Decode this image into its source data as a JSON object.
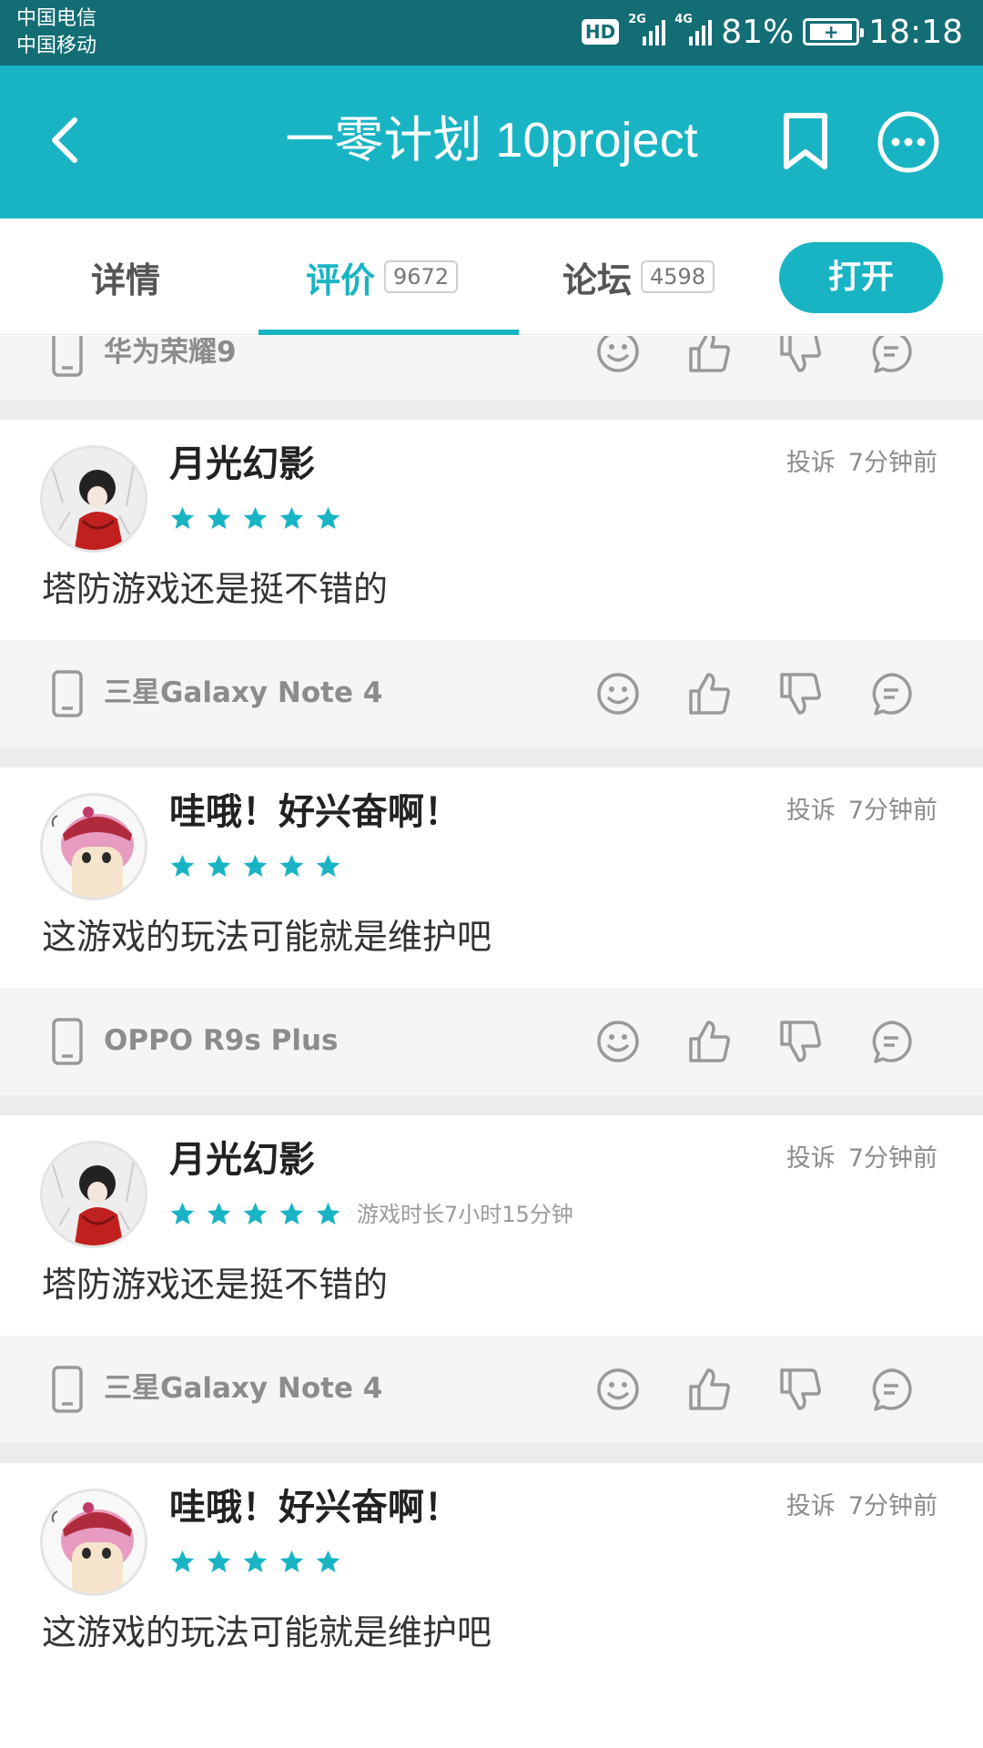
{
  "status_bar": {
    "carrier1": "中国电信",
    "carrier2": "中国移动",
    "hd": "HD",
    "net1": "2G",
    "net2": "4G",
    "battery": "81%",
    "time": "18:18"
  },
  "header": {
    "title": "一零计划 10project",
    "back_icon": "chevron-left-icon",
    "bookmark_icon": "bookmark-icon",
    "more_icon": "more-icon"
  },
  "tabs": [
    {
      "label": "详情"
    },
    {
      "label": "评价",
      "count": "9672"
    },
    {
      "label": "论坛",
      "count": "4598"
    }
  ],
  "open_button": "打开",
  "colors": {
    "accent": "#18b4c4",
    "status_bar": "#136d74"
  },
  "partial_footer": {
    "device": "华为荣耀9"
  },
  "reviews": [
    {
      "user": "月光幻影",
      "rating": 5,
      "report": "投诉",
      "time": "7分钟前",
      "playtime": "",
      "text": "塔防游戏还是挺不错的",
      "device": "三星Galaxy Note 4"
    },
    {
      "user": "哇哦！好兴奋啊！",
      "rating": 5,
      "report": "投诉",
      "time": "7分钟前",
      "playtime": "",
      "text": "这游戏的玩法可能就是维护吧",
      "device": "OPPO R9s Plus"
    },
    {
      "user": "月光幻影",
      "rating": 5,
      "report": "投诉",
      "time": "7分钟前",
      "playtime": "游戏时长7小时15分钟",
      "text": "塔防游戏还是挺不错的",
      "device": "三星Galaxy Note 4"
    },
    {
      "user": "哇哦！好兴奋啊！",
      "rating": 5,
      "report": "投诉",
      "time": "7分钟前",
      "playtime": "",
      "text": "这游戏的玩法可能就是维护吧",
      "device": ""
    }
  ]
}
